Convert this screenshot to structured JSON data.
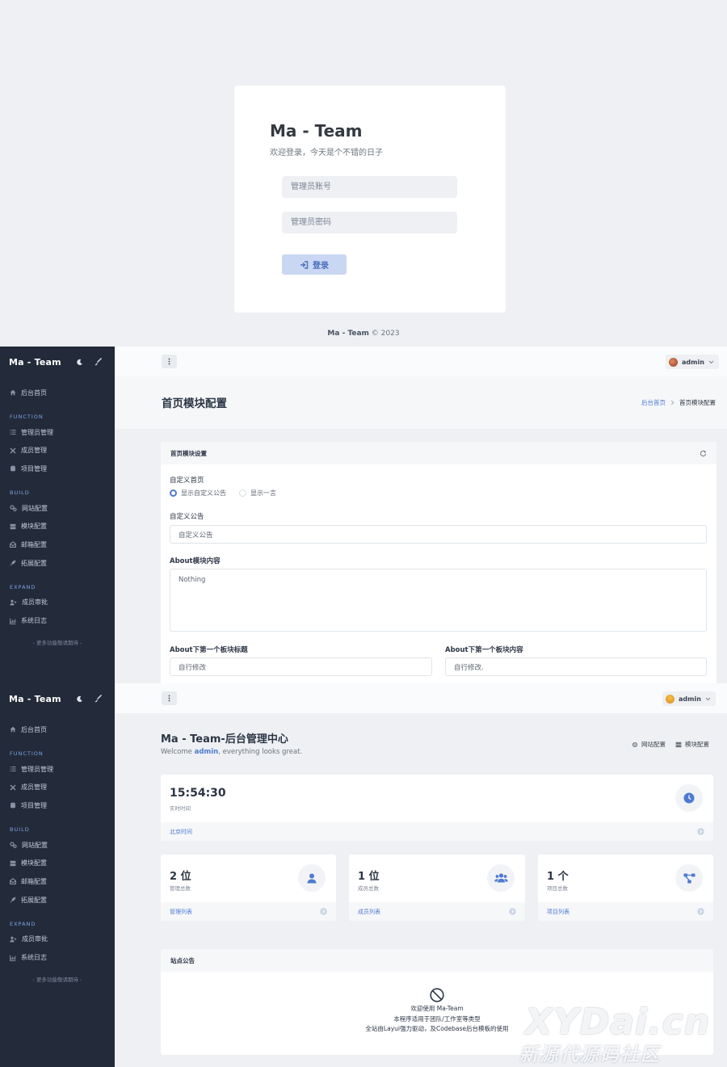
{
  "login": {
    "title": "Ma - Team",
    "subtitle": "欢迎登录，今天是个不错的日子",
    "username_placeholder": "管理员账号",
    "password_placeholder": "管理员密码",
    "login_label": "登录",
    "footer_brand": "Ma - Team",
    "footer_rest": " © 2023"
  },
  "sidebar": {
    "brand": "Ma - Team",
    "home": "后台首页",
    "groups": [
      {
        "title": "FUNCTION",
        "items": [
          "管理员管理",
          "成员管理",
          "项目管理"
        ]
      },
      {
        "title": "BUILD",
        "items": [
          "网站配置",
          "模块配置",
          "邮箱配置",
          "拓展配置"
        ]
      },
      {
        "title": "EXPAND",
        "items": [
          "成员审批",
          "系统日志"
        ]
      }
    ],
    "more": "- 更多功能敬请期待 -"
  },
  "topbar": {
    "user": "admin"
  },
  "module_page": {
    "title": "首页模块配置",
    "breadcrumb": [
      "后台首页",
      "首页模块配置"
    ],
    "panel_title": "首页模块设置",
    "field_home": "自定义首页",
    "radio_custom": "显示自定义公告",
    "radio_quote": "显示一言",
    "field_notice": "自定义公告",
    "notice_value": "自定义公告",
    "field_about": "About模块内容",
    "about_value": "Nothing",
    "field_block_title": "About下第一个板块标题",
    "block_title_value": "自行修改",
    "field_block_content": "About下第一个板块内容",
    "block_content_value": "自行修改."
  },
  "dashboard": {
    "title": "Ma - Team-后台管理中心",
    "welcome_pre": "Welcome ",
    "welcome_user": "admin",
    "welcome_post": ", everything looks great.",
    "action_site": "网站配置",
    "action_module": "模块配置",
    "time_value": "15:54:30",
    "time_label": "实时时间",
    "time_link": "北京时间",
    "stats": [
      {
        "value": "2 位",
        "label": "管理总数",
        "link": "管理列表"
      },
      {
        "value": "1 位",
        "label": "成员总数",
        "link": "成员列表"
      },
      {
        "value": "1 个",
        "label": "项目总数",
        "link": "项目列表"
      }
    ],
    "notice_title": "站点公告",
    "notice_lines": [
      "欢迎使用 Ma-Team",
      "本程序适用于团队/工作室等类型",
      "全站由Layui强力驱动，及Codebase后台模板的使用"
    ]
  },
  "watermark": {
    "main": "XYDai.cn",
    "sub": "新源代源码社区"
  },
  "colors": {
    "accent": "#4f7ad1",
    "sidebar": "#232b3a",
    "page_bg": "#eef0f3"
  }
}
